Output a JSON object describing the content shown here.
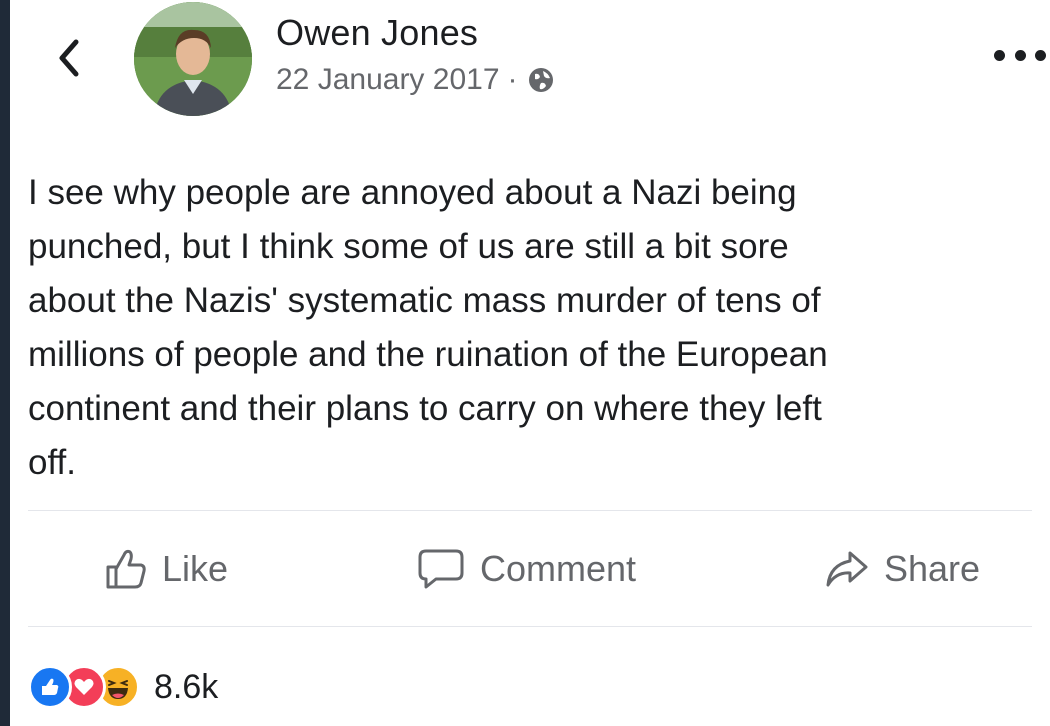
{
  "post": {
    "author": "Owen Jones",
    "date": "22 January 2017",
    "separator": "·",
    "privacy_icon": "globe-icon",
    "text": "I see why people are annoyed about a Nazi being\npunched, but I think some of us are still a bit sore\nabout the Nazis' systematic mass murder of tens of\nmillions of people and the ruination of the European\ncontinent and their plans to carry on where they left\noff."
  },
  "actions": {
    "like_label": "Like",
    "comment_label": "Comment",
    "share_label": "Share"
  },
  "reactions": {
    "count": "8.6k",
    "icons": [
      "like-reaction-icon",
      "love-reaction-icon",
      "haha-reaction-icon"
    ]
  },
  "colors": {
    "like_blue": "#1877f2",
    "love_red": "#f33e58",
    "haha_yellow": "#f7b125",
    "secondary_text": "#65676b",
    "primary_text": "#1c1e21"
  }
}
